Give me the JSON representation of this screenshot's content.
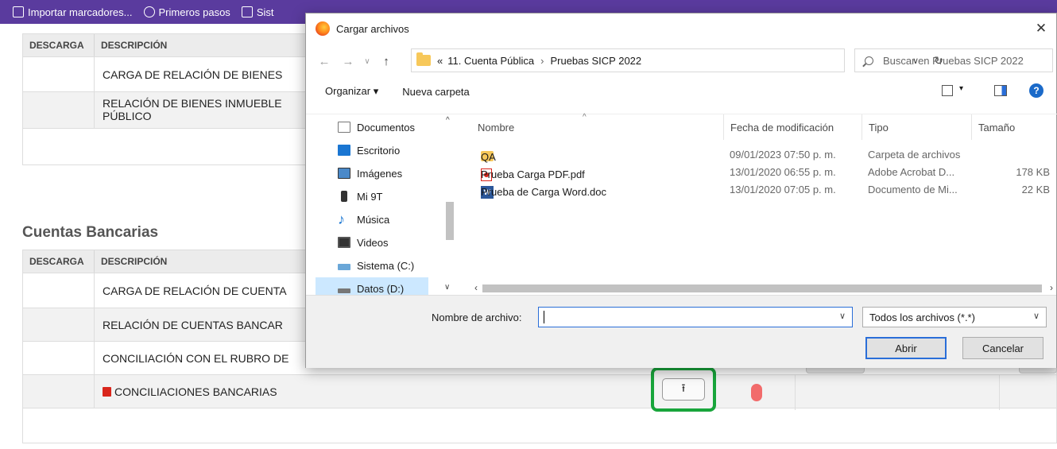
{
  "bookmarks": [
    {
      "label": "Importar marcadores...",
      "icon": "import-icon"
    },
    {
      "label": "Primeros pasos",
      "icon": "globe-icon"
    },
    {
      "label": "Sist",
      "icon": "bookmark-icon"
    }
  ],
  "table1": {
    "headers": [
      "DESCARGA",
      "DESCRIPCIÓN"
    ],
    "rows": [
      "CARGA DE RELACIÓN DE BIENES",
      "RELACIÓN DE BIENES INMUEBLE\nPÚBLICO",
      ""
    ]
  },
  "section2": {
    "title": "Cuentas Bancarias"
  },
  "table2": {
    "headers": [
      "DESCARGA",
      "DESCRIPCIÓN"
    ],
    "rows": [
      "CARGA DE RELACIÓN DE CUENTA",
      "RELACIÓN DE CUENTAS BANCAR",
      "CONCILIACIÓN CON EL RUBRO DE",
      "CONCILIACIONES BANCARIAS",
      ""
    ]
  },
  "upload": {
    "icon": "upload-icon"
  },
  "colors": {
    "bookmark_bar": "#5a3b9e",
    "highlight": "#18a53b",
    "accent": "#2a6ed8",
    "status_red": "#f26b6b"
  },
  "dialog": {
    "title": "Cargar archivos",
    "address": {
      "prefix": "«",
      "crumb1": "11. Cuenta Pública",
      "separator": "›",
      "crumb2": "Pruebas SICP 2022"
    },
    "search_placeholder": "Buscar en Pruebas SICP 2022",
    "commands": {
      "organize": "Organizar ▾",
      "new_folder": "Nueva carpeta"
    },
    "nav": [
      {
        "label": "Documentos",
        "icon": "documents-icon"
      },
      {
        "label": "Escritorio",
        "icon": "desktop-icon"
      },
      {
        "label": "Imágenes",
        "icon": "pictures-icon"
      },
      {
        "label": "Mi 9T",
        "icon": "phone-icon"
      },
      {
        "label": "Música",
        "icon": "music-icon"
      },
      {
        "label": "Videos",
        "icon": "videos-icon"
      },
      {
        "label": "Sistema (C:)",
        "icon": "drive-c-icon"
      },
      {
        "label": "Datos (D:)",
        "icon": "drive-d-icon"
      }
    ],
    "columns": {
      "name": "Nombre",
      "date": "Fecha de modificación",
      "type": "Tipo",
      "size": "Tamaño"
    },
    "files": [
      {
        "name": "QA",
        "date": "09/01/2023 07:50 p. m.",
        "type": "Carpeta de archivos",
        "size": "",
        "icon": "folder-icon"
      },
      {
        "name": "Prueba Carga PDF.pdf",
        "date": "13/01/2020 06:55 p. m.",
        "type": "Adobe Acrobat D...",
        "size": "178 KB",
        "icon": "pdf-icon"
      },
      {
        "name": "Prueba de Carga Word.doc",
        "date": "13/01/2020 07:05 p. m.",
        "type": "Documento de Mi...",
        "size": "22 KB",
        "icon": "word-icon"
      }
    ],
    "filename_label": "Nombre de archivo:",
    "filename_value": "",
    "filter": "Todos los archivos (*.*)",
    "open_button": "Abrir",
    "cancel_button": "Cancelar"
  }
}
